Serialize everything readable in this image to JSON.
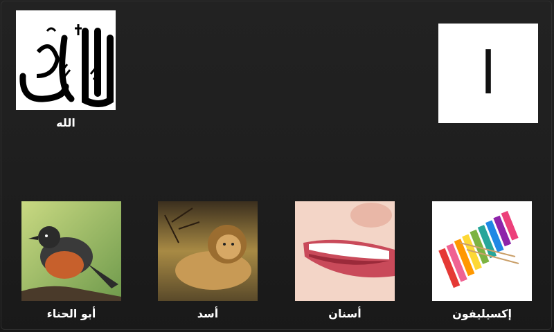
{
  "header": {
    "featured_item": {
      "label": "الله",
      "image_icon": "allah-calligraphy-icon"
    },
    "current_letter": {
      "glyph": "ا"
    }
  },
  "words": [
    {
      "label": "إكسيليفون",
      "image_icon": "xylophone-image"
    },
    {
      "label": "أسنان",
      "image_icon": "teeth-image"
    },
    {
      "label": "أسد",
      "image_icon": "lion-image"
    },
    {
      "label": "أبو الحناء",
      "image_icon": "robin-bird-image"
    }
  ],
  "colors": {
    "background": "#1f1f1f",
    "caption_text": "#ffffff"
  }
}
